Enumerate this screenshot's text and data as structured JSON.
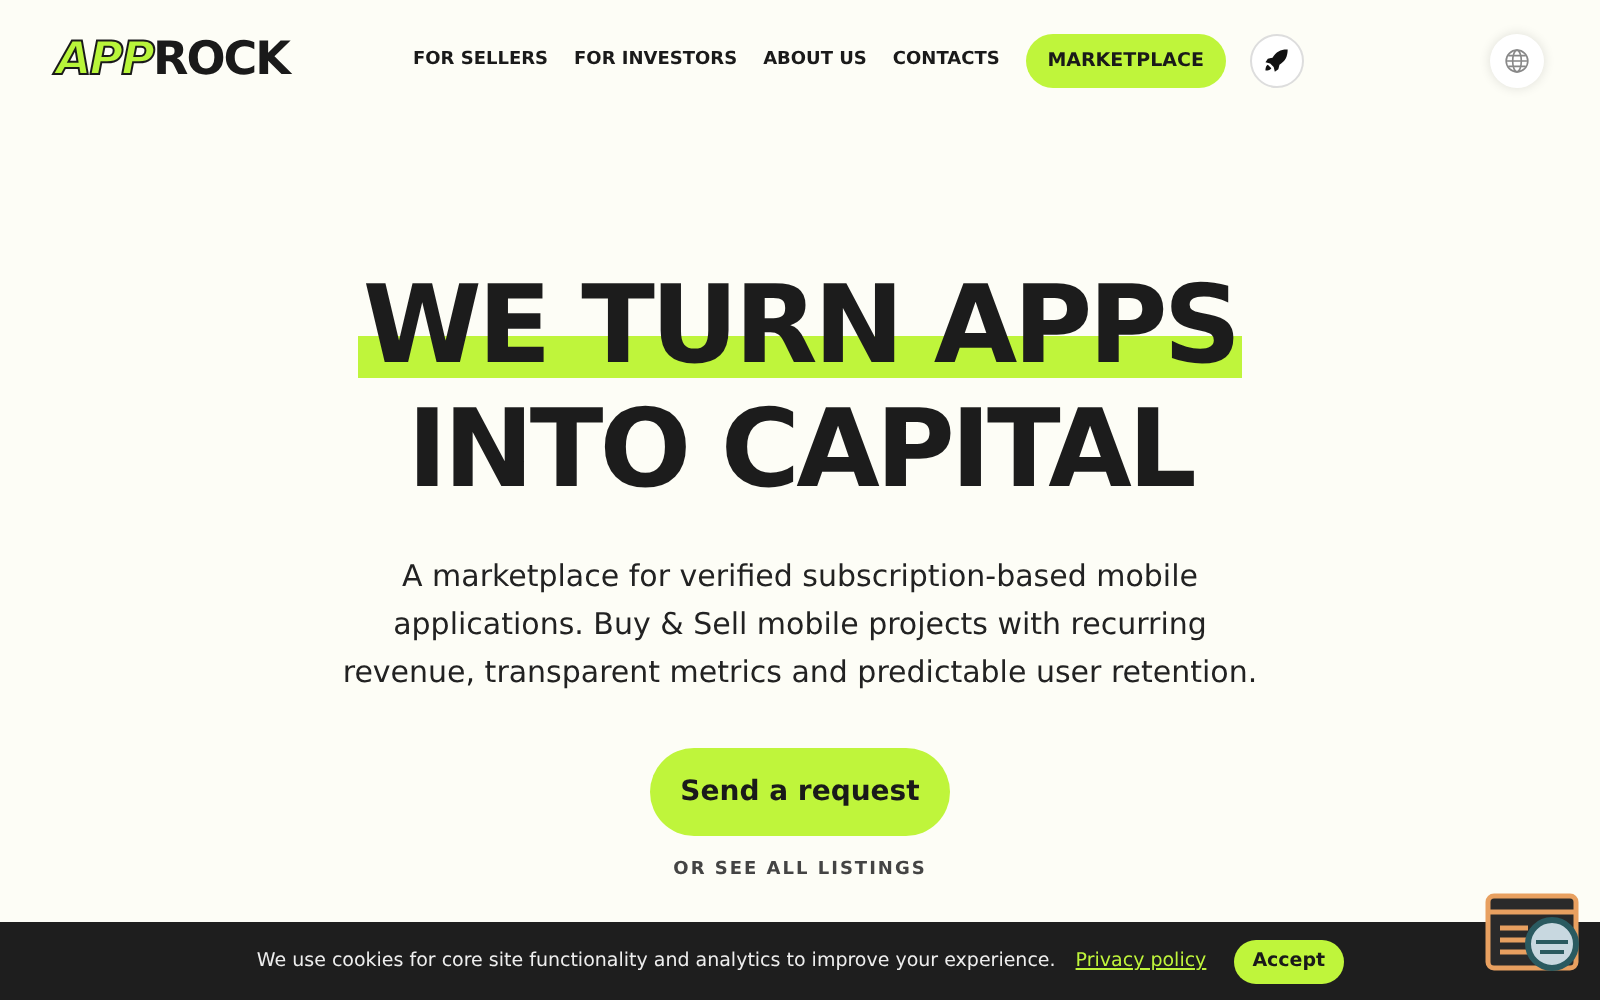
{
  "logo": {
    "accent": "APP",
    "rest": "ROCK"
  },
  "nav": [
    "FOR SELLERS",
    "FOR INVESTORS",
    "ABOUT US",
    "CONTACTS"
  ],
  "marketplace_button": "MARKETPLACE",
  "hero": {
    "title_lines": [
      "WE TURN APPS",
      "INTO CAPITAL"
    ],
    "subtitle": "A marketplace for verified subscription-based mobile applications. Buy & Sell mobile projects with recurring revenue, transparent metrics and predictable user retention.",
    "cta": "Send a request",
    "secondary_link": "OR SEE ALL LISTINGS"
  },
  "cookie_bar": {
    "text": "We use cookies for core site functionality and analytics to improve your experience.",
    "link": "Privacy policy",
    "button": "Accept"
  }
}
